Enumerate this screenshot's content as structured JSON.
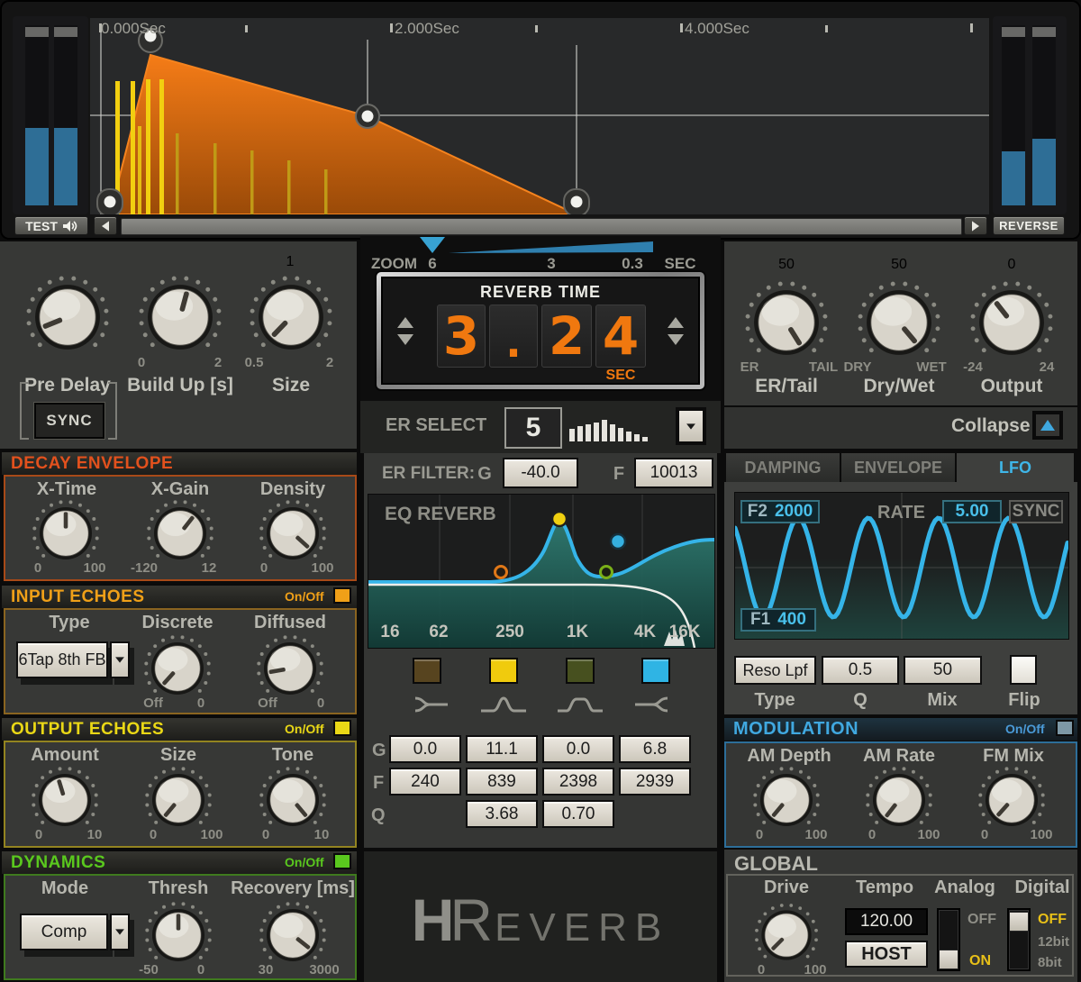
{
  "transport": {
    "test": "TEST",
    "reverse": "REVERSE"
  },
  "timeline": {
    "labels": [
      "0.000Sec",
      "2.000Sec",
      "4.000Sec"
    ]
  },
  "zoombar": {
    "label": "ZOOM",
    "tick1": "6",
    "tick2": "3",
    "tick3": "0.3",
    "unit": "SEC"
  },
  "reverb_time": {
    "title": "REVERB TIME",
    "d1": "3",
    "dot": ".",
    "d2": "2",
    "d3": "4",
    "unit": "SEC",
    "digit_color": "#f0780f"
  },
  "er_select": {
    "label": "ER SELECT",
    "value": "5"
  },
  "er_filter": {
    "label": "ER FILTER:",
    "g_label": "G",
    "g_value": "-40.0",
    "f_label": "F",
    "f_value": "10013"
  },
  "eq": {
    "title": "EQ REVERB",
    "freqs": [
      "16",
      "62",
      "250",
      "1K",
      "4K",
      "16K"
    ],
    "band_colors": [
      "#57441f",
      "#f0cb0d",
      "#47501f",
      "#2fb4e4"
    ],
    "row_g": "G",
    "row_f": "F",
    "row_q": "Q",
    "g": [
      "0.0",
      "11.1",
      "0.0",
      "6.8"
    ],
    "f": [
      "240",
      "839",
      "2398",
      "2939"
    ],
    "q": [
      "3.68",
      "0.70"
    ]
  },
  "top_left": {
    "sync": "SYNC",
    "knobs": [
      {
        "label": "Pre Delay",
        "angle": -112
      },
      {
        "label": "Build Up [s]",
        "min": "0",
        "max": "2",
        "angle": 15
      },
      {
        "label": "Size",
        "top": "1",
        "min": "0.5",
        "max": "2",
        "angle": -136
      }
    ]
  },
  "decay": {
    "title": "DECAY ENVELOPE",
    "knobs": [
      {
        "label": "X-Time",
        "min": "0",
        "max": "100",
        "angle": 0
      },
      {
        "label": "X-Gain",
        "min": "-120",
        "max": "12",
        "angle": 38
      },
      {
        "label": "Density",
        "min": "0",
        "max": "100",
        "angle": 132
      }
    ]
  },
  "input_echoes": {
    "title": "INPUT ECHOES",
    "onoff": "On/Off",
    "type_label": "Type",
    "type_value": "6Tap 8th FB",
    "knobs": [
      {
        "label": "Discrete",
        "min": "Off",
        "max": "0",
        "angle": -138
      },
      {
        "label": "Diffused",
        "min": "Off",
        "max": "0",
        "angle": -100
      }
    ]
  },
  "output_echoes": {
    "title": "OUTPUT ECHOES",
    "onoff": "On/Off",
    "knobs": [
      {
        "label": "Amount",
        "min": "0",
        "max": "10",
        "angle": -17
      },
      {
        "label": "Size",
        "min": "0",
        "max": "100",
        "angle": -140
      },
      {
        "label": "Tone",
        "min": "0",
        "max": "10",
        "angle": 140
      }
    ]
  },
  "dynamics": {
    "title": "DYNAMICS",
    "onoff": "On/Off",
    "mode_label": "Mode",
    "mode_value": "Comp",
    "knobs": [
      {
        "label": "Thresh",
        "min": "-50",
        "max": "0",
        "angle": 0
      },
      {
        "label": "Recovery [ms]",
        "min": "30",
        "max": "3000",
        "angle": 128
      }
    ]
  },
  "outputs": {
    "knobs": [
      {
        "top": "50",
        "min": "ER",
        "max": "TAIL",
        "label": "ER/Tail",
        "angle": 148
      },
      {
        "top": "50",
        "min": "DRY",
        "max": "WET",
        "label": "Dry/Wet",
        "angle": 140
      },
      {
        "top": "0",
        "min": "-24",
        "max": "24",
        "label": "Output",
        "angle": -38
      }
    ]
  },
  "collapse": {
    "label": "Collapse"
  },
  "tabs": [
    {
      "label": "DAMPING"
    },
    {
      "label": "ENVELOPE"
    },
    {
      "label": "LFO"
    }
  ],
  "lfo": {
    "f2_label": "F2",
    "f2_value": "2000",
    "rate_label": "RATE",
    "rate_value": "5.00",
    "sync": "SYNC",
    "f1_label": "F1",
    "f1_value": "400",
    "type_value": "Reso Lpf",
    "q_value": "0.5",
    "mix_value": "50",
    "type_label": "Type",
    "q_label": "Q",
    "mix_label": "Mix",
    "flip_label": "Flip",
    "wave_color": "#35b4e8"
  },
  "modulation": {
    "title": "MODULATION",
    "onoff": "On/Off",
    "knobs": [
      {
        "label": "AM Depth",
        "min": "0",
        "max": "100",
        "angle": -140
      },
      {
        "label": "AM Rate",
        "min": "0",
        "max": "100",
        "angle": -142
      },
      {
        "label": "FM Mix",
        "min": "0",
        "max": "100",
        "angle": -138
      }
    ]
  },
  "global": {
    "title": "GLOBAL",
    "drive": {
      "label": "Drive",
      "min": "0",
      "max": "100",
      "angle": -135
    },
    "tempo_label": "Tempo",
    "tempo_value": "120.00",
    "host": "HOST",
    "analog_label": "Analog",
    "analog_off": "OFF",
    "analog_on": "ON",
    "digital_label": "Digital",
    "digital_off": "OFF",
    "digital_12": "12bit",
    "digital_8": "8bit"
  },
  "logo": {
    "h": "H",
    "r": "R",
    "rest": "EVERB"
  }
}
